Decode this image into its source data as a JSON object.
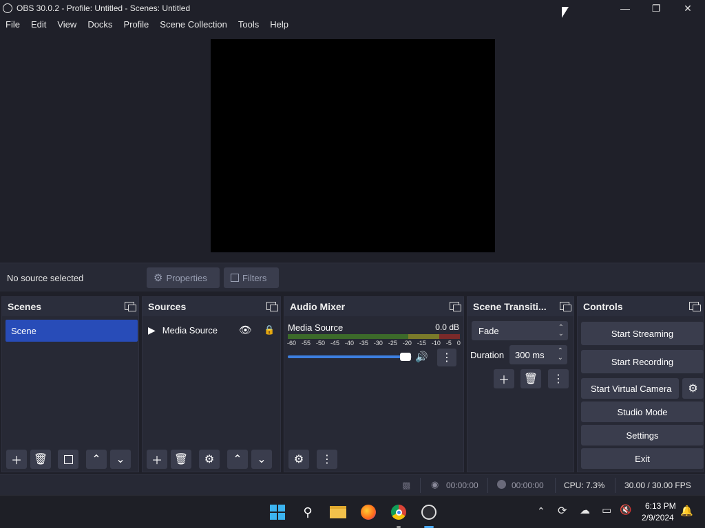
{
  "window": {
    "title": "OBS 30.0.2 - Profile: Untitled - Scenes: Untitled",
    "min_icon": "minimize-icon",
    "max_icon": "maximize-icon",
    "close_icon": "close-icon"
  },
  "menu": [
    "File",
    "Edit",
    "View",
    "Docks",
    "Profile",
    "Scene Collection",
    "Tools",
    "Help"
  ],
  "context_bar": {
    "no_source": "No source selected",
    "properties": "Properties",
    "filters": "Filters"
  },
  "scenes": {
    "title": "Scenes",
    "items": [
      "Scene"
    ]
  },
  "sources": {
    "title": "Sources",
    "items": [
      "Media Source"
    ]
  },
  "audio_mixer": {
    "title": "Audio Mixer",
    "track_name": "Media Source",
    "level": "0.0 dB",
    "ticks": [
      "-60",
      "-55",
      "-50",
      "-45",
      "-40",
      "-35",
      "-30",
      "-25",
      "-20",
      "-15",
      "-10",
      "-5",
      "0"
    ],
    "volume_fraction": 0.95
  },
  "transitions": {
    "title": "Scene Transiti...",
    "selected": "Fade",
    "duration_label": "Duration",
    "duration_value": "300 ms"
  },
  "controls": {
    "title": "Controls",
    "start_streaming": "Start Streaming",
    "start_recording": "Start Recording",
    "start_virtual_camera": "Start Virtual Camera",
    "studio_mode": "Studio Mode",
    "settings": "Settings",
    "exit": "Exit"
  },
  "status": {
    "stream_time": "00:00:00",
    "rec_time": "00:00:00",
    "cpu": "CPU: 7.3%",
    "fps": "30.00 / 30.00 FPS"
  },
  "taskbar": {
    "time": "6:13 PM",
    "date": "2/9/2024"
  },
  "colors": {
    "selected_scene": "#284cb8",
    "panel": "#272935",
    "button": "#3a3d4d",
    "background": "#1f2029"
  }
}
